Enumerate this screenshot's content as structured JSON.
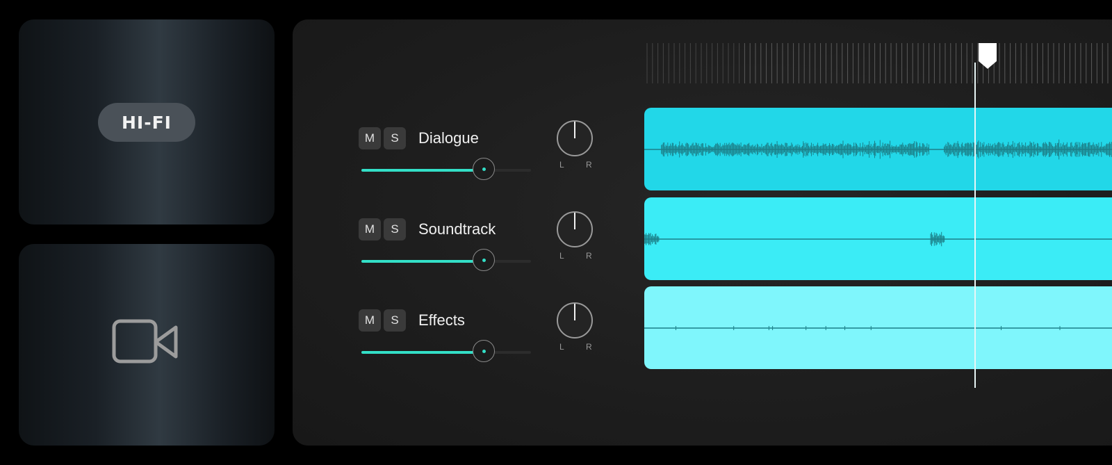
{
  "hifi_tile": {
    "badge": "HI-FI"
  },
  "video_tile": {
    "icon": "video-camera-icon"
  },
  "mixer": {
    "buttons": {
      "mute": "M",
      "solo": "S"
    },
    "pan": {
      "left": "L",
      "right": "R"
    },
    "tracks": [
      {
        "name": "Dialogue",
        "volume": 0.72,
        "pan": 0.0,
        "clip_color": "#22d7e8",
        "waveform": "dense"
      },
      {
        "name": "Soundtrack",
        "volume": 0.72,
        "pan": 0.0,
        "clip_color": "#3becf6",
        "waveform": "sparse"
      },
      {
        "name": "Effects",
        "volume": 0.72,
        "pan": 0.0,
        "clip_color": "#7ff6fc",
        "waveform": "flat"
      }
    ]
  },
  "colors": {
    "accent": "#33dfc7",
    "background": "#000000",
    "panel": "#1f1f1f"
  },
  "timeline": {
    "playhead_icon": "playhead-marker-icon"
  }
}
